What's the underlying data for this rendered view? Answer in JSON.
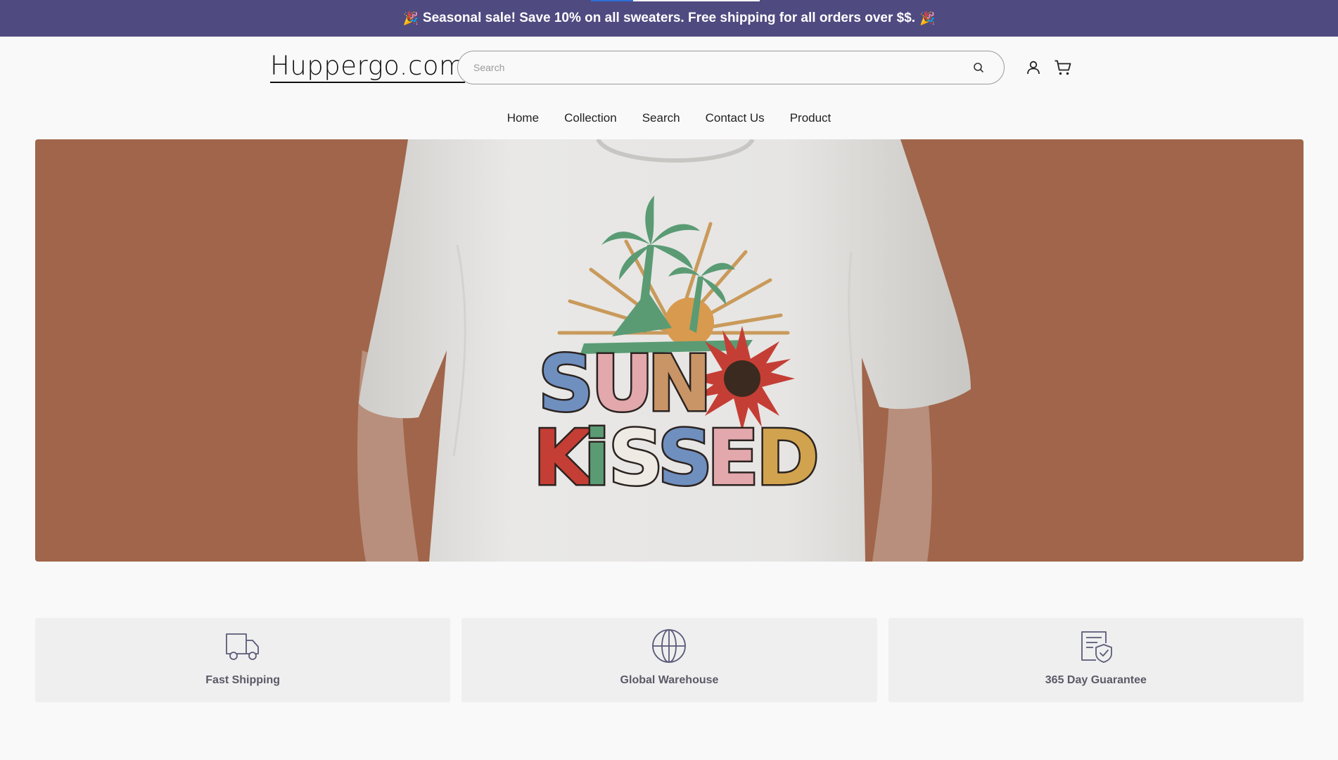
{
  "announcement": {
    "text": "Seasonal sale! Save 10% on all sweaters. Free shipping for all orders over $$.",
    "icon_left": "party-popper-icon",
    "icon_right": "party-popper-icon",
    "background": "#4f4a80",
    "slide_progress": 0.25
  },
  "header": {
    "logo": "Huppergo.com",
    "search": {
      "placeholder": "Search",
      "value": "",
      "icon": "search-icon"
    },
    "account_icon": "user-icon",
    "cart_icon": "cart-icon"
  },
  "nav": {
    "items": [
      {
        "label": "Home"
      },
      {
        "label": "Collection"
      },
      {
        "label": "Search"
      },
      {
        "label": "Contact Us"
      },
      {
        "label": "Product"
      }
    ]
  },
  "hero": {
    "image": "t-shirt-banner-image",
    "shirt_graphic": {
      "line1": "SUN",
      "line2": "KISSED"
    },
    "background": "#a0654a"
  },
  "features": [
    {
      "icon": "truck-icon",
      "label": "Fast Shipping"
    },
    {
      "icon": "globe-icon",
      "label": "Global Warehouse"
    },
    {
      "icon": "guarantee-badge-icon",
      "label": "365 Day Guarantee"
    }
  ]
}
